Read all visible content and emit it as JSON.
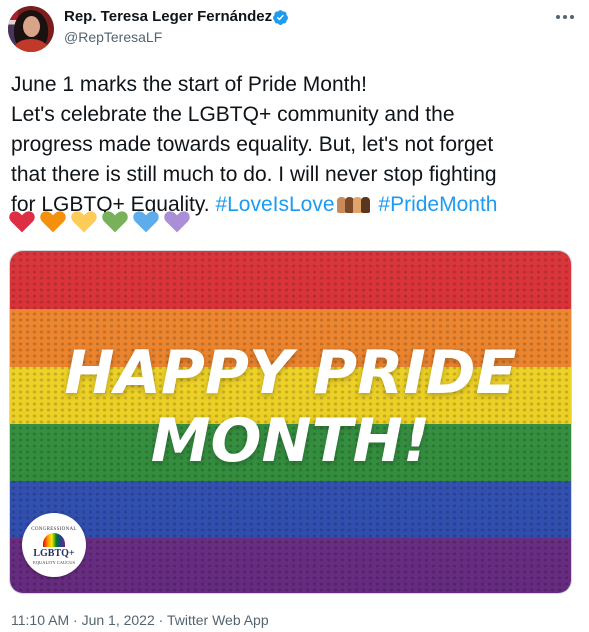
{
  "author": {
    "name": "Rep. Teresa Leger Fernández",
    "handle": "@RepTeresaLF",
    "verified_icon": "verified-badge-icon"
  },
  "tweet": {
    "lines": [
      "June 1 marks the start of Pride Month!",
      "Let's celebrate the LGBTQ+ community and the",
      "progress made towards equality. But, let's not forget",
      "that there is still much to do. I will never stop fighting",
      "for LGBTQ+ Equality."
    ],
    "hashtags": [
      "#LoveIsLove",
      "#PrideMonth"
    ],
    "hearts": [
      "red-heart",
      "orange-heart",
      "yellow-heart",
      "green-heart",
      "blue-heart",
      "purple-heart"
    ]
  },
  "media": {
    "headline": [
      "HAPPY PRIDE",
      "MONTH!"
    ],
    "stripe_colors": [
      "#d8252b",
      "#ee7f22",
      "#f2d31c",
      "#2f8f3a",
      "#2f4fb5",
      "#6b2d86"
    ],
    "badge": {
      "top": "CONGRESSIONAL",
      "main": "LGBTQ+",
      "bottom": "EQUALITY CAUCUS"
    }
  },
  "meta": {
    "time": "11:10 AM",
    "date": "Jun 1, 2022",
    "app": "Twitter Web App",
    "separator": "·"
  },
  "colors": {
    "link": "#1d9bf0",
    "secondary_text": "#536471"
  }
}
